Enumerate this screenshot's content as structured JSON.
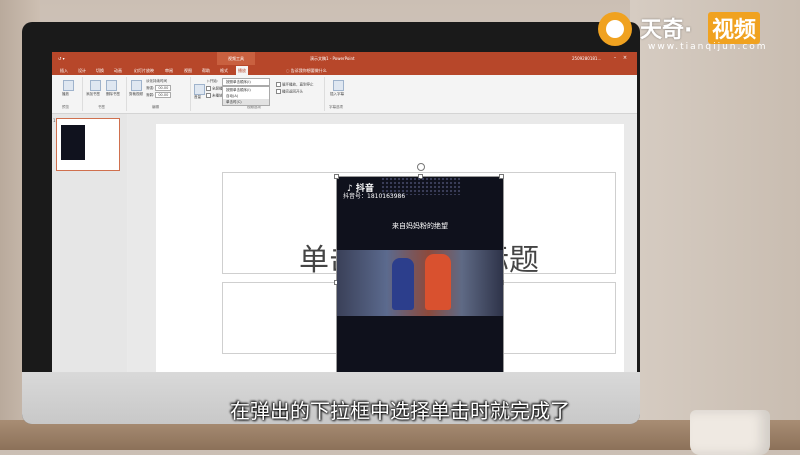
{
  "window": {
    "quick_access": "↺ ▾",
    "context_tab": "视频工具",
    "document_title": "演示文稿1 - PowerPoint",
    "user": "2509280181..."
  },
  "tabs": [
    "插入",
    "设计",
    "切换",
    "动画",
    "幻灯片放映",
    "审阅",
    "视图",
    "帮助",
    "格式",
    "播放"
  ],
  "active_tab_index": 9,
  "tell_me": "告诉我你想要做什么",
  "ribbon": {
    "groups": [
      {
        "label": "预览",
        "items": [
          "播放"
        ]
      },
      {
        "label": "书签",
        "items": [
          "添加书签",
          "删除书签"
        ]
      },
      {
        "label": "编辑",
        "items": [
          "剪裁视频",
          "渐强:",
          "渐弱:"
        ],
        "fade_in": "00.00",
        "fade_out": "00.00",
        "fade_label": "淡化持续时间"
      },
      {
        "label": "视频选项",
        "items": [
          "音量",
          "开始:",
          "全屏播放",
          "未播放时隐藏",
          "循环播放，直到停止",
          "播完返回开头"
        ]
      },
      {
        "label": "字幕选项",
        "items": [
          "插入字幕"
        ]
      }
    ],
    "start_dropdown": {
      "options": [
        "按照单击顺序(I)",
        "自动(A)",
        "单击时(C)"
      ],
      "highlighted": 2,
      "current": "按照单击顺序(I)"
    }
  },
  "thumbnail": {
    "number": "1"
  },
  "slide": {
    "title_placeholder": "单击此处添加标题"
  },
  "video": {
    "app_logo": "♪ 抖音",
    "account": "抖音号：1810163986",
    "caption": "来自妈妈粉的绝望"
  },
  "subtitle": "在弹出的下拉框中选择单击时就完成了",
  "watermark": {
    "brand": "天奇·",
    "brand2": "视频",
    "url": "www.tianqijun.com"
  },
  "colors": {
    "accent": "#b7472a",
    "logo": "#f0a220"
  }
}
